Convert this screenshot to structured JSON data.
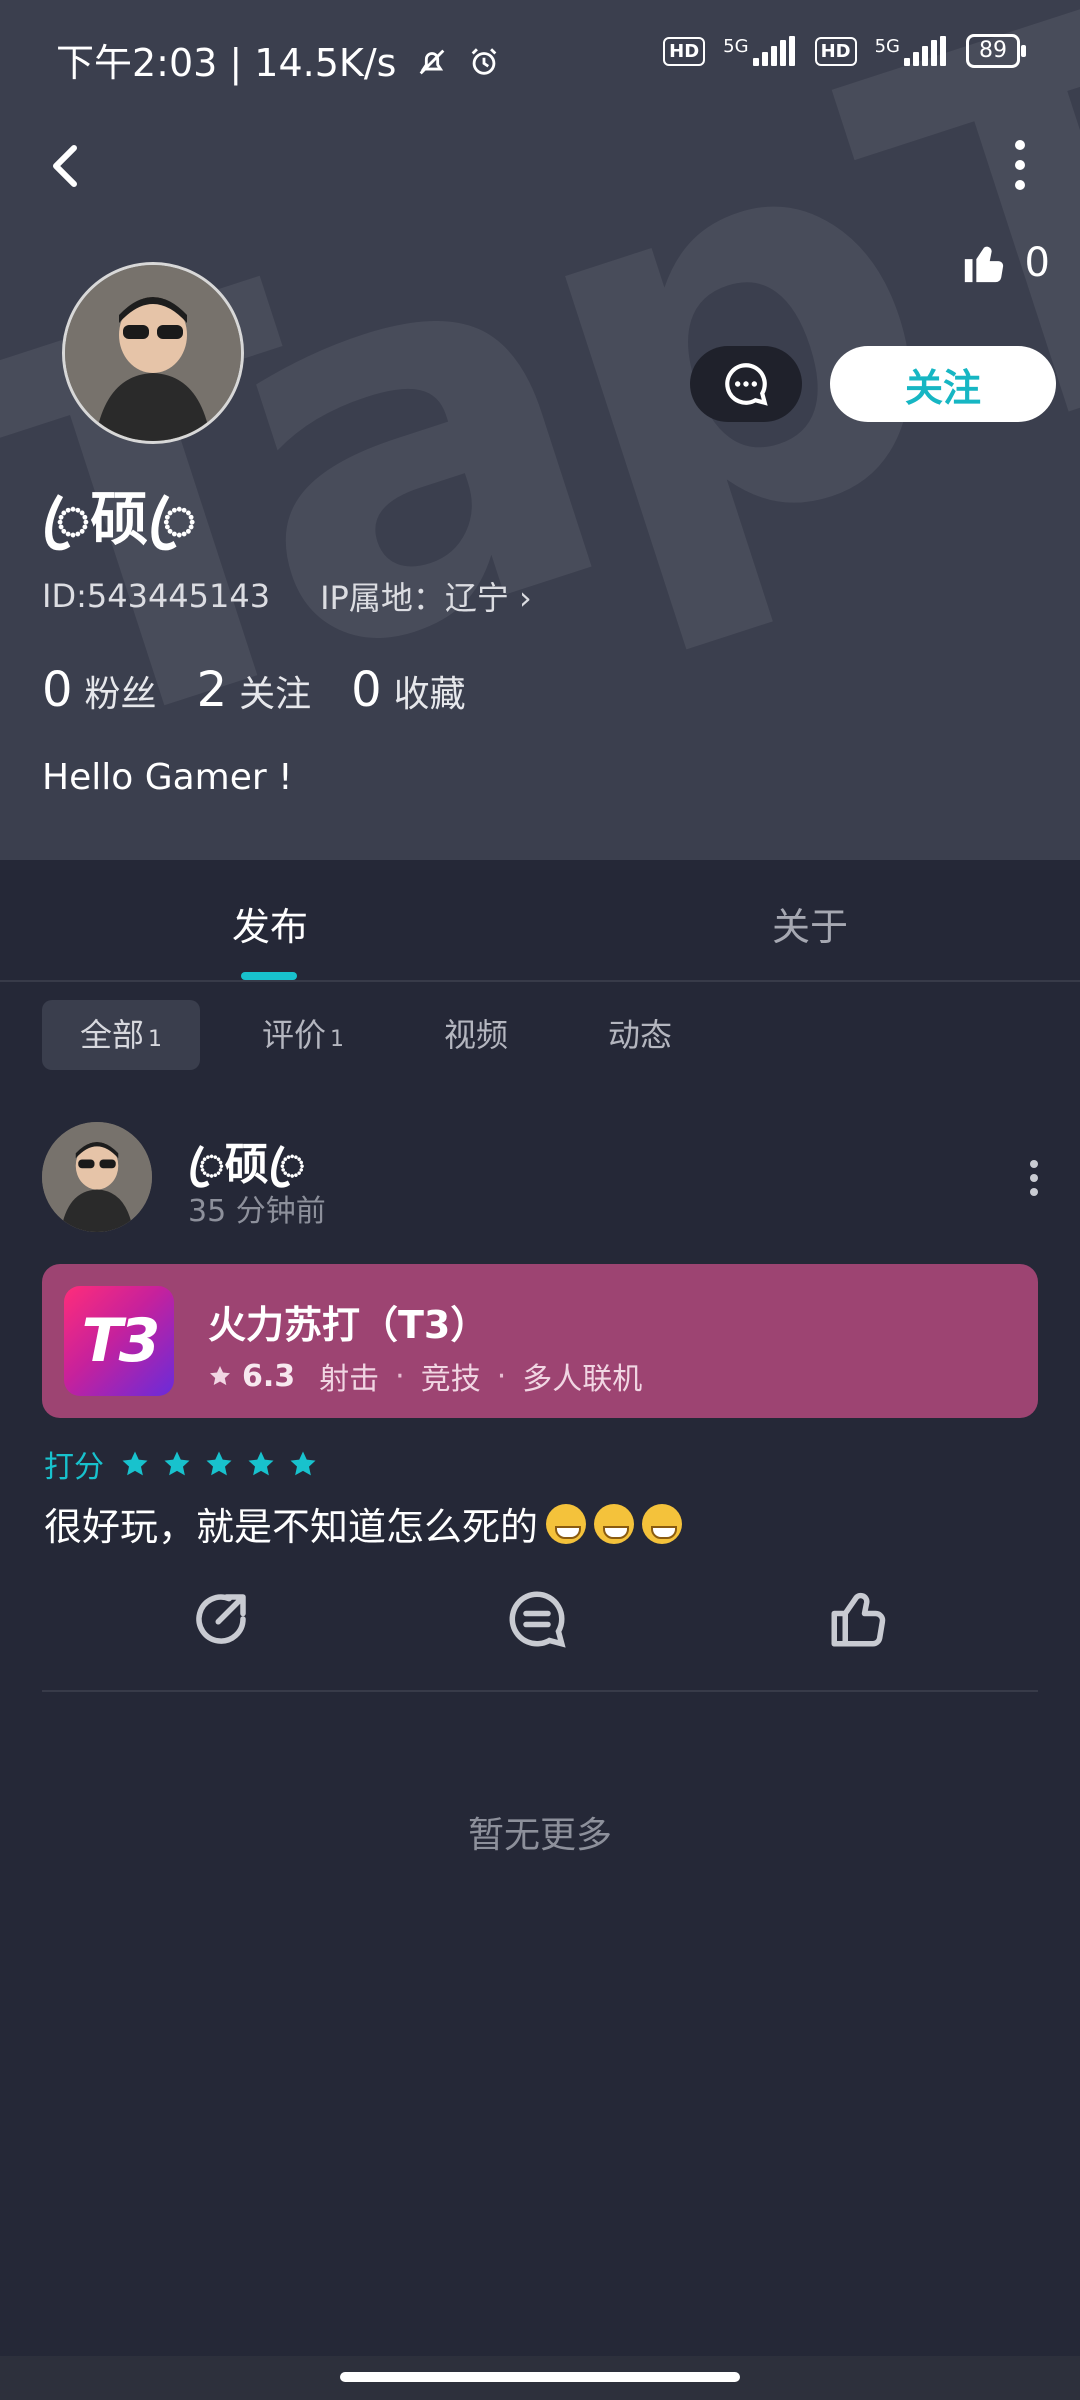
{
  "status_bar": {
    "time": "下午2:03 | 14.5K/s",
    "hd1": "HD",
    "net1": "5G",
    "hd2": "HD",
    "net2": "5G",
    "battery": "89"
  },
  "header": {
    "watermark": "TapTap",
    "likes_count": "0",
    "follow_label": "关注",
    "username": "ꦿ硕ꦿ",
    "id_text": "ID:543445143",
    "ip_text": "IP属地：辽宁 ›",
    "stats": [
      {
        "num": "0",
        "label": "粉丝"
      },
      {
        "num": "2",
        "label": "关注"
      },
      {
        "num": "0",
        "label": "收藏"
      }
    ],
    "bio": "Hello Gamer !"
  },
  "tabs": [
    {
      "label": "发布",
      "active": true
    },
    {
      "label": "关于",
      "active": false
    }
  ],
  "filters": [
    {
      "label": "全部",
      "count": "1",
      "active": true
    },
    {
      "label": "评价",
      "count": "1",
      "active": false
    },
    {
      "label": "视频",
      "count": "",
      "active": false
    },
    {
      "label": "动态",
      "count": "",
      "active": false
    }
  ],
  "post": {
    "username": "ꦿ硕ꦿ",
    "time": "35 分钟前",
    "game": {
      "name": "火力苏打（T3）",
      "icon_text": "T3",
      "score": "6.3",
      "tags": [
        "射击",
        "竞技",
        "多人联机"
      ]
    },
    "rating_label": "打分",
    "rating": 5,
    "review": "很好玩，就是不知道怎么死的"
  },
  "footer_text": "暂无更多",
  "colors": {
    "accent": "#18c2cd",
    "background": "#252837",
    "header": "#3b3f4e",
    "game_card": "#9d4472"
  }
}
